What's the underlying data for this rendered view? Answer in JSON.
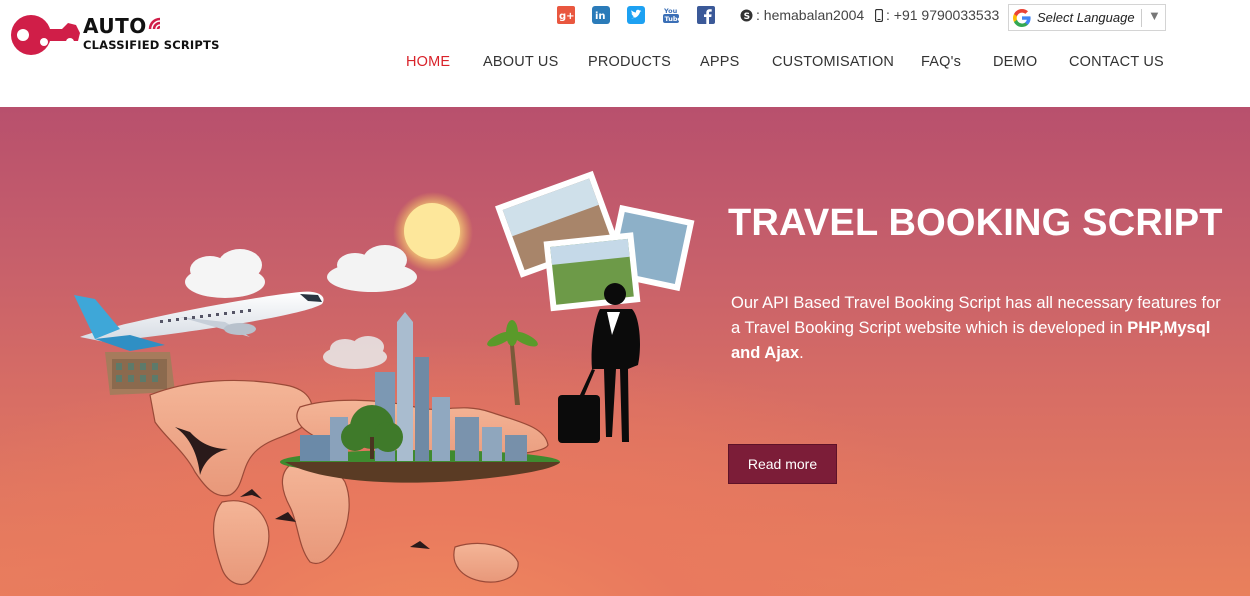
{
  "brand": {
    "line1": "AUTO",
    "line2": "CLASSIFIED SCRIPTS",
    "accent": "#d01e48"
  },
  "header": {
    "social": [
      {
        "icon": "google-plus-icon",
        "color": "#dd4b39"
      },
      {
        "icon": "linkedin-icon",
        "color": "#0e76a8"
      },
      {
        "icon": "twitter-icon",
        "color": "#1da1f2"
      },
      {
        "icon": "youtube-icon",
        "color": "#3b6fb6"
      },
      {
        "icon": "facebook-icon",
        "color": "#3b5998"
      }
    ],
    "skype": ": hemabalan2004",
    "phone": ": +91 9790033533",
    "language": {
      "label": "Select Language",
      "arrow": "▼"
    }
  },
  "nav": {
    "items": [
      {
        "label": "HOME",
        "active": true
      },
      {
        "label": "ABOUT US"
      },
      {
        "label": "PRODUCTS"
      },
      {
        "label": "APPS"
      },
      {
        "label": "CUSTOMISATION"
      },
      {
        "label": "FAQ's"
      },
      {
        "label": "DEMO"
      },
      {
        "label": "CONTACT US"
      }
    ],
    "active_color": "#d9222a"
  },
  "hero": {
    "title": "TRAVEL BOOKING SCRIPT",
    "desc_plain": "Our API Based Travel Booking Script has all necessary features for a Travel Booking Script website which is developed in ",
    "desc_bold": "PHP,Mysql and Ajax",
    "desc_end": ".",
    "button": "Read more",
    "button_color": "#7c1d38"
  }
}
